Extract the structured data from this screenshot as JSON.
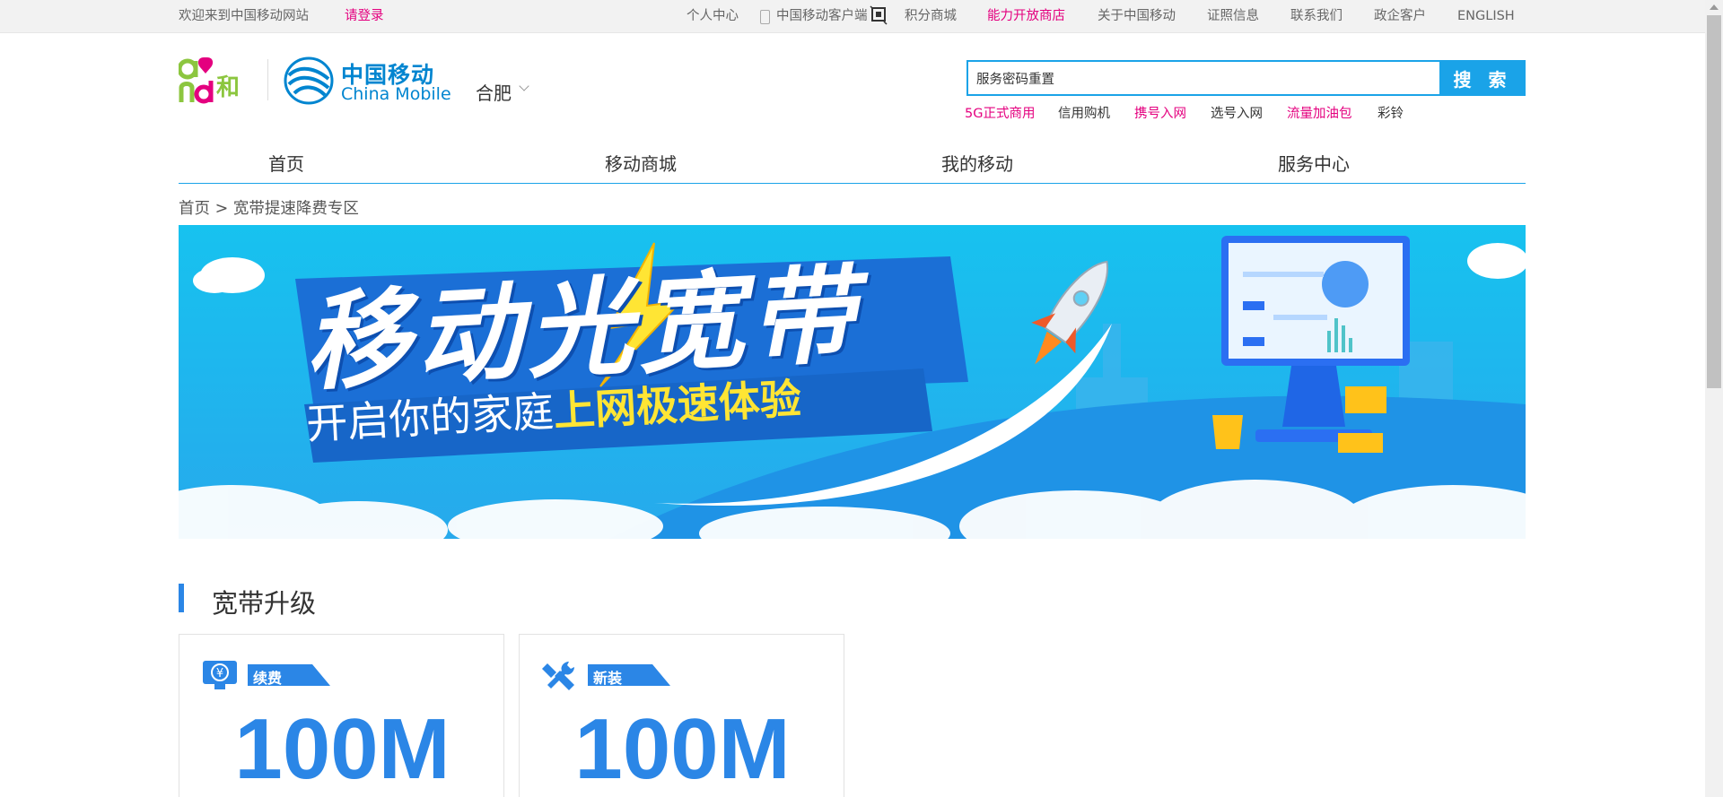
{
  "topbar": {
    "welcome": "欢迎来到中国移动网站",
    "login": "请登录",
    "links": [
      "个人中心",
      "中国移动客户端",
      "积分商城",
      "能力开放商店",
      "关于中国移动",
      "证照信息",
      "联系我们",
      "政企客户",
      "ENGLISH"
    ]
  },
  "header": {
    "logo_cn": "中国移动",
    "logo_en": "China Mobile",
    "city": "合肥",
    "search_value": "服务密码重置",
    "search_button": "搜 索",
    "hot_links": [
      "5G正式商用",
      "信用购机",
      "携号入网",
      "选号入网",
      "流量加油包",
      "彩铃"
    ]
  },
  "nav": {
    "items": [
      "首页",
      "移动商城",
      "我的移动",
      "服务中心"
    ]
  },
  "breadcrumb": {
    "home": "首页",
    "sep": ">",
    "current": "宽带提速降费专区"
  },
  "banner": {
    "title": "移动光宽带",
    "subtitle_a": "开启你的家庭",
    "subtitle_b": "上网极速体验"
  },
  "section": {
    "title": "宽带升级",
    "cards": [
      {
        "tag": "续费",
        "speed": "100M",
        "icon": "yuan-monitor-icon"
      },
      {
        "tag": "新装",
        "speed": "100M",
        "icon": "tools-icon"
      }
    ]
  },
  "colors": {
    "accent": "#1aa3e8",
    "pink": "#e4007f",
    "blue": "#2b86e6",
    "banner_sky": "#1ec3ef"
  }
}
